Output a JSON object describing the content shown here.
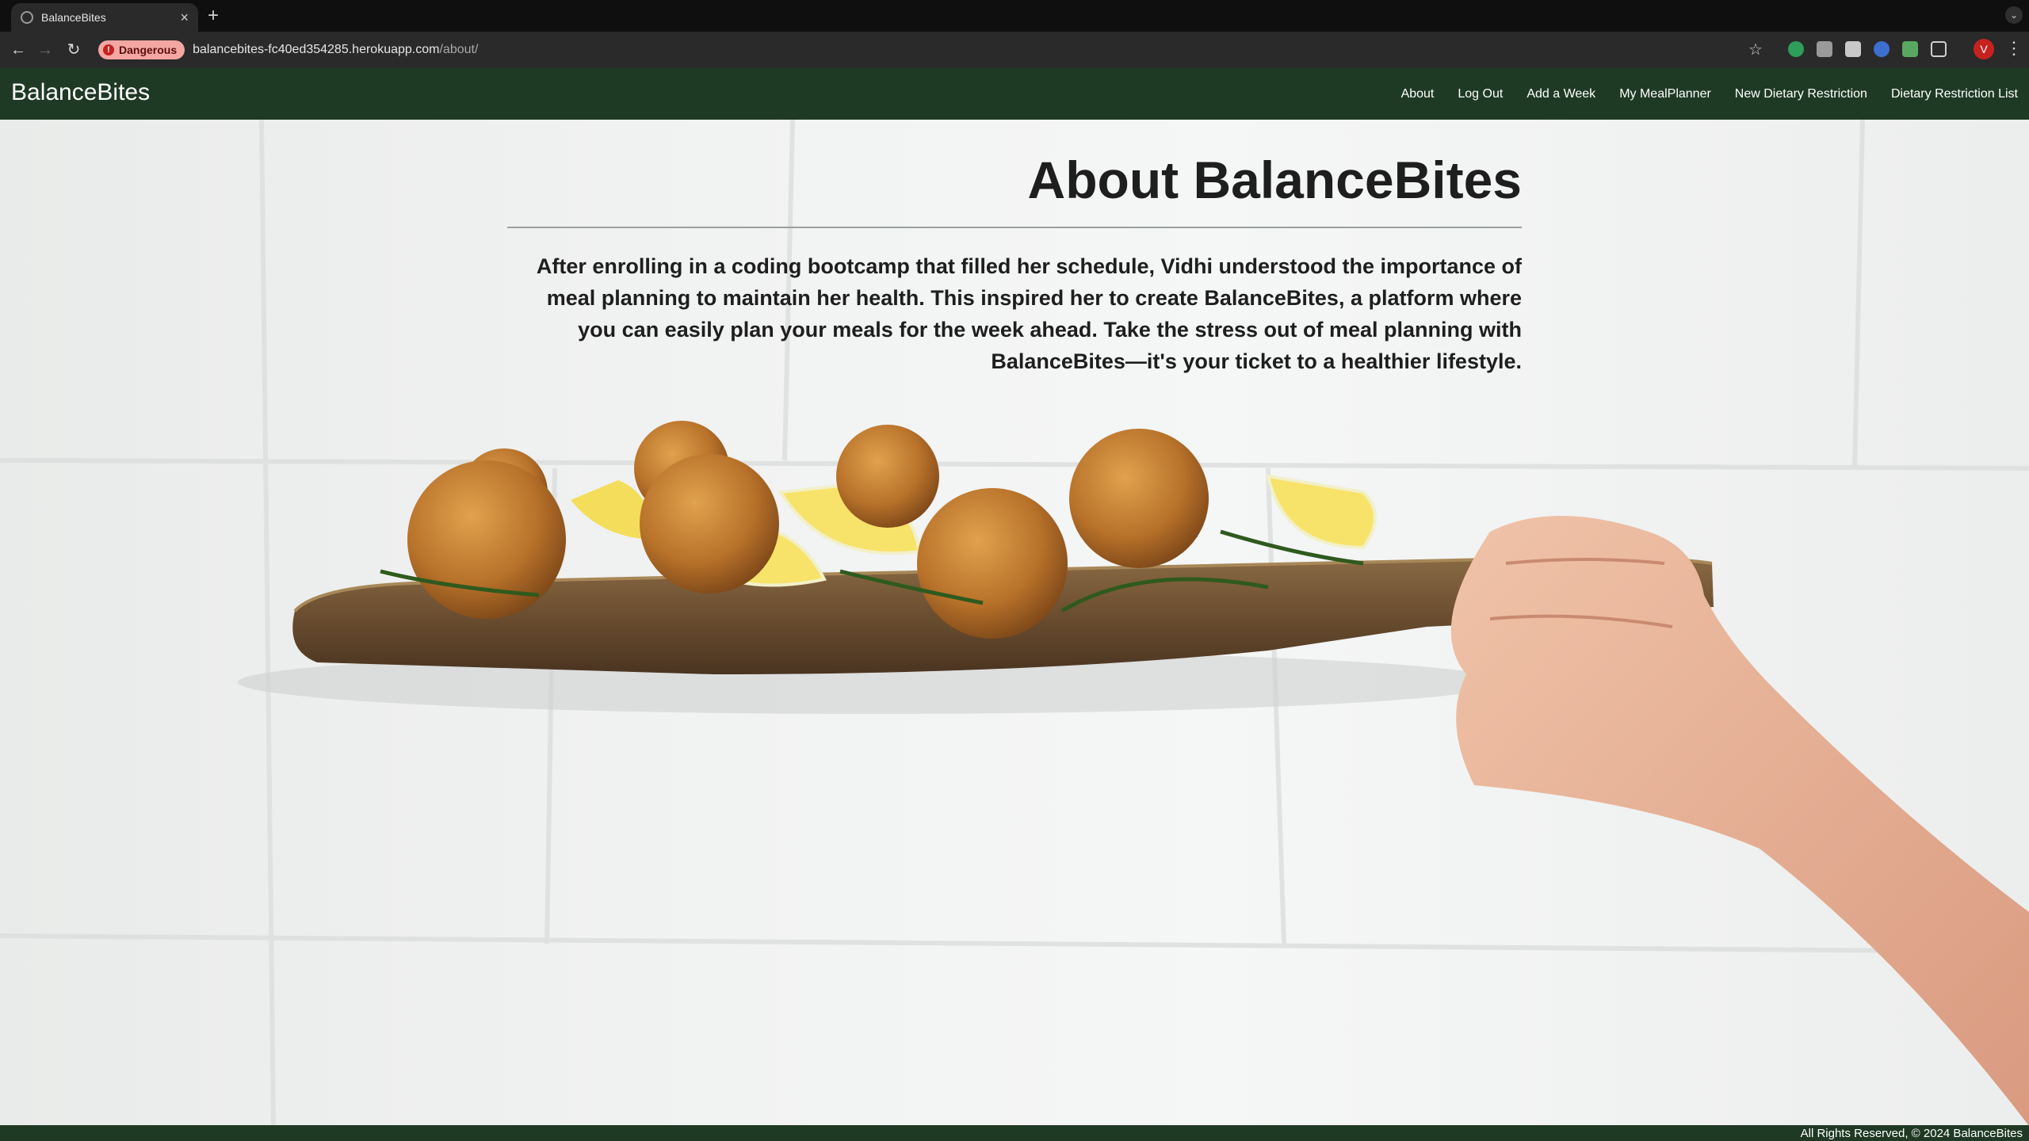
{
  "browser": {
    "tab_title": "BalanceBites",
    "security_badge": "Dangerous",
    "url_host": "balancebites-fc40ed354285.herokuapp.com",
    "url_path": "/about/",
    "profile_initial": "V"
  },
  "site": {
    "brand": "BalanceBites",
    "nav": [
      "About",
      "Log Out",
      "Add a Week",
      "My MealPlanner",
      "New Dietary Restriction",
      "Dietary Restriction List"
    ]
  },
  "about": {
    "title": "About BalanceBites",
    "body": "After enrolling in a coding bootcamp that filled her schedule, Vidhi understood the importance of meal planning to maintain her health. This inspired her to create BalanceBites, a platform where you can easily plan your meals for the week ahead. Take the stress out of meal planning with BalanceBites—it's your ticket to a healthier lifestyle."
  },
  "footer": {
    "text": "All Rights Reserved, © 2024 BalanceBites"
  },
  "colors": {
    "navbar": "#1f3a24",
    "danger_badge": "#f2a7a3"
  }
}
